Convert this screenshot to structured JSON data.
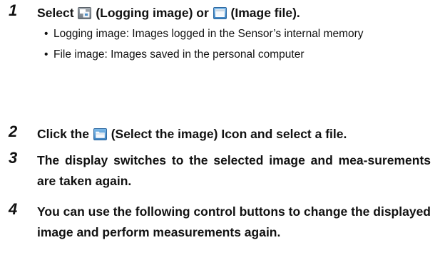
{
  "steps": [
    {
      "number": "1",
      "parts": [
        "Select",
        "(Logging image) or",
        "(Image file)."
      ],
      "icons": [
        "logging-image-icon",
        "image-file-icon"
      ],
      "bullets": [
        "Logging image: Images logged in the Sensor’s internal memory",
        "File image: Images saved in the personal computer"
      ]
    },
    {
      "number": "2",
      "parts": [
        "Click the",
        "(Select the image) Icon and select a file."
      ],
      "icons": [
        "select-image-folder-icon"
      ]
    },
    {
      "number": "3",
      "text": "The display switches to the selected image and mea-surements are taken again."
    },
    {
      "number": "4",
      "text": "You can use the following control buttons to change the displayed image and perform measurements again."
    }
  ],
  "colors": {
    "icon_blue": "#4a8fc9",
    "icon_gray": "#8e959c"
  }
}
